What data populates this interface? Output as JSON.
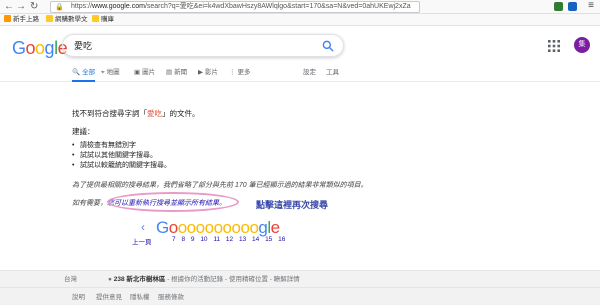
{
  "browser": {
    "url_host": "www.google.com",
    "url_prefix": "https://",
    "url_rest": "/search?q=愛吃&ei=k4wdXbawHszy8AWlqlgo&start=170&sa=N&ved=0ahUKEwj2xZa",
    "bookmarks": [
      "新手上路",
      "網購數學文",
      "購庫"
    ]
  },
  "header": {
    "logo_letters": [
      "G",
      "o",
      "o",
      "g",
      "l",
      "e"
    ],
    "search_value": "愛吃",
    "avatar_letter": "集"
  },
  "tabs": {
    "all": "全部",
    "maps": "地圖",
    "images": "圖片",
    "news": "新聞",
    "videos": "影片",
    "more": "更多",
    "settings": "設定",
    "tools": "工具"
  },
  "results": {
    "no_results_prefix": "找不到符合搜尋字詞「",
    "keyword": "愛吃",
    "no_results_suffix": "」的文件。",
    "suggest_title": "建議：",
    "suggestions": [
      "請檢查有無錯別字",
      "試試以其他關鍵字搜尋。",
      "試試以較籠統的關鍵字搜尋。"
    ],
    "omitted_text": "為了提供最相關的搜尋結果，我們省略了部分與先前 170 筆已經顯示過的結果非常類似的項目。",
    "omitted_prefix": "如有需要，",
    "omitted_link": "您可以重新執行搜尋並顯示所有結果",
    "omitted_suffix": "。",
    "annotation": "點擊這裡再次搜尋"
  },
  "pagination": {
    "prev_arrow": "‹",
    "prev_label": "上一頁",
    "logo_text": "Goooooooooogle",
    "pages": [
      "7",
      "8",
      "9",
      "10",
      "11",
      "12",
      "13",
      "14",
      "15",
      "16"
    ]
  },
  "footer": {
    "country": "台灣",
    "location_dot": "●",
    "location_bold": "238 新北市樹林區",
    "location_rest": " - 根據你的活動記錄 - 使用精確位置 - 瞭解詳情",
    "links": [
      "說明",
      "提供意見",
      "隱私權",
      "服務條款"
    ]
  },
  "colors": {
    "google_blue": "#4285f4",
    "google_red": "#ea4335",
    "google_yellow": "#fbbc05",
    "google_green": "#34a853",
    "link": "#1a0dab",
    "annotation": "#3949ab",
    "highlight": "#e89ac8"
  }
}
